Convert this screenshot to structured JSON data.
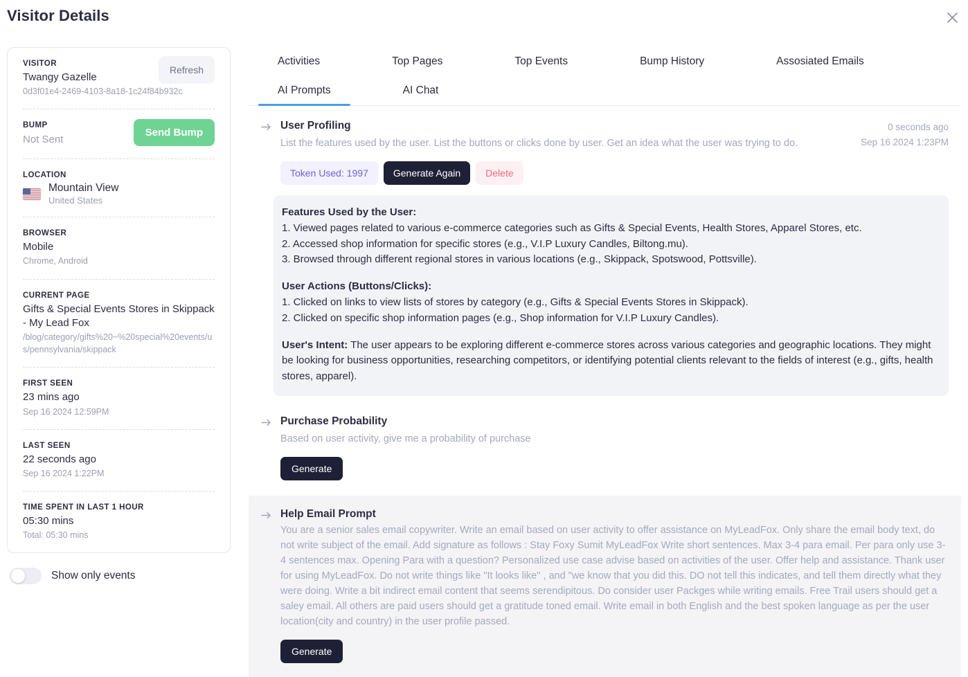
{
  "header": {
    "title": "Visitor Details",
    "close_icon": "close-icon"
  },
  "sidebar": {
    "visitor": {
      "label": "VISITOR",
      "name": "Twangy Gazelle",
      "id": "0d3f01e4-2469-4103-8a18-1c24f84b932c",
      "refresh_label": "Refresh"
    },
    "bump": {
      "label": "BUMP",
      "status": "Not Sent",
      "send_label": "Send Bump"
    },
    "location": {
      "label": "LOCATION",
      "city": "Mountain View",
      "country": "United States",
      "flag_icon": "us-flag-icon"
    },
    "browser": {
      "label": "BROWSER",
      "device": "Mobile",
      "details": "Chrome, Android"
    },
    "current_page": {
      "label": "CURRENT PAGE",
      "title": "Gifts & Special Events Stores in Skippack - My Lead Fox",
      "path": "/blog/category/gifts%20~%20special%20events/us/pennsylvania/skippack"
    },
    "first_seen": {
      "label": "FIRST SEEN",
      "relative": "23 mins ago",
      "absolute": "Sep 16 2024 12:59PM"
    },
    "last_seen": {
      "label": "LAST SEEN",
      "relative": "22 seconds ago",
      "absolute": "Sep 16 2024 1:22PM"
    },
    "time_spent": {
      "label": "TIME SPENT IN LAST 1 HOUR",
      "value": "05:30 mins",
      "total": "Total: 05:30 mins"
    },
    "show_only_events_label": "Show only events",
    "show_only_events_on": false
  },
  "tabs": [
    {
      "label": "Activities",
      "active": false
    },
    {
      "label": "Top Pages",
      "active": false
    },
    {
      "label": "Top Events",
      "active": false
    },
    {
      "label": "Bump History",
      "active": false
    },
    {
      "label": "Assosiated Emails",
      "active": false
    },
    {
      "label": "AI Prompts",
      "active": true
    },
    {
      "label": "AI Chat",
      "active": false
    }
  ],
  "prompts": {
    "user_profiling": {
      "title": "User Profiling",
      "description": "List the features used by the user. List the buttons or clicks done by user. Get an idea what the user was trying to do.",
      "relative_time": "0 seconds ago",
      "absolute_time": "Sep 16 2024 1:23PM",
      "token_label": "Token Used: 1997",
      "generate_again_label": "Generate Again",
      "delete_label": "Delete",
      "result": {
        "features_heading": "Features Used by the User:",
        "features": [
          "1. Viewed pages related to various e-commerce categories such as Gifts & Special Events, Health Stores, Apparel Stores, etc.",
          "2. Accessed shop information for specific stores (e.g., V.I.P Luxury Candles, Biltong.mu).",
          "3. Browsed through different regional stores in various locations (e.g., Skippack, Spotswood, Pottsville)."
        ],
        "actions_heading": "User Actions (Buttons/Clicks):",
        "actions": [
          "1. Clicked on links to view lists of stores by category (e.g., Gifts & Special Events Stores in Skippack).",
          "2. Clicked on specific shop information pages (e.g., Shop information for V.I.P Luxury Candles)."
        ],
        "intent_heading": "User's Intent:",
        "intent_text": " The user appears to be exploring different e-commerce stores across various categories and geographic locations. They might be looking for business opportunities, researching competitors, or identifying potential clients relevant to the fields of interest (e.g., gifts, health stores, apparel)."
      }
    },
    "purchase_probability": {
      "title": "Purchase Probability",
      "description": "Based on user activity, give me a probability of purchase",
      "generate_label": "Generate"
    },
    "help_email_prompt": {
      "title": "Help Email Prompt",
      "description": "You are a senior sales email copywriter. Write an email based on user activity to offer assistance on MyLeadFox. Only share the email body text, do not write subject of the email. Add signature as follows : Stay Foxy Sumit MyLeadFox Write short sentences. Max 3-4 para email. Per para only use 3-4 sentences max. Opening Para with a question? Personalized use case advise based on activities of the user. Offer help and assistance. Thank user for using MyLeadFox. Do not write things like \"It looks like\" , and \"we know that you did this. DO not tell this indicates, and tell them directly what they were doing. Write a bit indirect email content that seems serendipitous. Do consider user Packges while writing emails. Free Trail users should get a saley email. All others are paid users should get a gratitude toned email. Write email in both English and the best spoken language as per the user location(city and country) in the user profile passed.",
      "generate_label": "Generate"
    }
  },
  "colors": {
    "accent_blue": "#4a9ee6",
    "bump_green": "#6fd394",
    "dark_button": "#1e2035",
    "token_purple": "#6c63d8",
    "delete_pink": "#f1697f"
  }
}
